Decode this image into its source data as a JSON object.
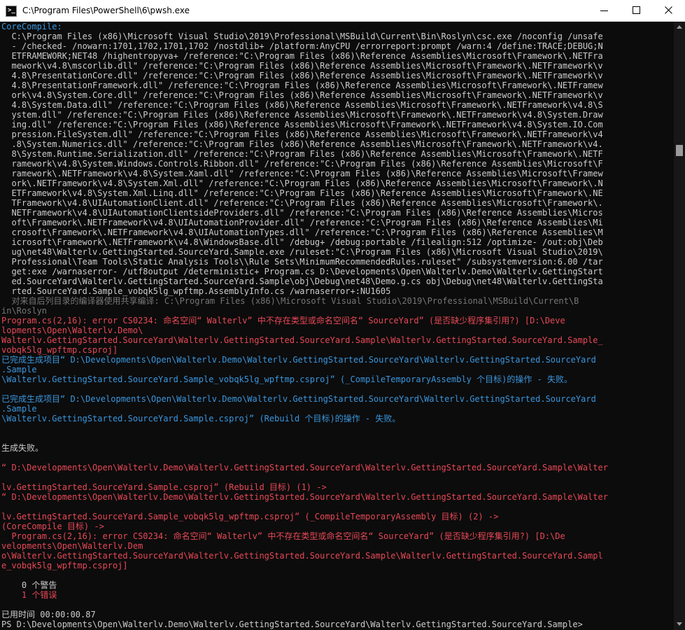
{
  "window": {
    "title": "C:\\Program Files\\PowerShell\\6\\pwsh.exe",
    "icon": "powershell-icon",
    "controls": [
      "minimize-icon",
      "maximize-icon",
      "close-icon"
    ]
  },
  "colors": {
    "background": "#0c0c0c",
    "default_text": "#cccccc",
    "label": "#3a96dd",
    "gray": "#767676",
    "error": "#e74856",
    "success": "#3a96dd"
  },
  "terminal": {
    "lines": [
      {
        "text": "CoreCompile:",
        "style": "label"
      },
      {
        "text": "  C:\\Program Files (x86)\\Microsoft Visual Studio\\2019\\Professional\\MSBuild\\Current\\Bin\\Roslyn\\csc.exe /noconfig /unsafe",
        "style": "def"
      },
      {
        "text": "  - /checked- /nowarn:1701,1702,1701,1702 /nostdlib+ /platform:AnyCPU /errorreport:prompt /warn:4 /define:TRACE;DEBUG;N",
        "style": "def"
      },
      {
        "text": "  ETFRAMEWORK;NET48 /highentropyva+ /reference:\"C:\\Program Files (x86)\\Reference Assemblies\\Microsoft\\Framework\\.NETFra",
        "style": "def"
      },
      {
        "text": "  mework\\v4.8\\mscorlib.dll\" /reference:\"C:\\Program Files (x86)\\Reference Assemblies\\Microsoft\\Framework\\.NETFramework\\v",
        "style": "def"
      },
      {
        "text": "  4.8\\PresentationCore.dll\" /reference:\"C:\\Program Files (x86)\\Reference Assemblies\\Microsoft\\Framework\\.NETFramework\\v",
        "style": "def"
      },
      {
        "text": "  4.8\\PresentationFramework.dll\" /reference:\"C:\\Program Files (x86)\\Reference Assemblies\\Microsoft\\Framework\\.NETFramew",
        "style": "def"
      },
      {
        "text": "  ork\\v4.8\\System.Core.dll\" /reference:\"C:\\Program Files (x86)\\Reference Assemblies\\Microsoft\\Framework\\.NETFramework\\v",
        "style": "def"
      },
      {
        "text": "  4.8\\System.Data.dll\" /reference:\"C:\\Program Files (x86)\\Reference Assemblies\\Microsoft\\Framework\\.NETFramework\\v4.8\\S",
        "style": "def"
      },
      {
        "text": "  ystem.dll\" /reference:\"C:\\Program Files (x86)\\Reference Assemblies\\Microsoft\\Framework\\.NETFramework\\v4.8\\System.Draw",
        "style": "def"
      },
      {
        "text": "  ing.dll\" /reference:\"C:\\Program Files (x86)\\Reference Assemblies\\Microsoft\\Framework\\.NETFramework\\v4.8\\System.IO.Com",
        "style": "def"
      },
      {
        "text": "  pression.FileSystem.dll\" /reference:\"C:\\Program Files (x86)\\Reference Assemblies\\Microsoft\\Framework\\.NETFramework\\v4",
        "style": "def"
      },
      {
        "text": "  .8\\System.Numerics.dll\" /reference:\"C:\\Program Files (x86)\\Reference Assemblies\\Microsoft\\Framework\\.NETFramework\\v4.",
        "style": "def"
      },
      {
        "text": "  8\\System.Runtime.Serialization.dll\" /reference:\"C:\\Program Files (x86)\\Reference Assemblies\\Microsoft\\Framework\\.NETF",
        "style": "def"
      },
      {
        "text": "  ramework\\v4.8\\System.Windows.Controls.Ribbon.dll\" /reference:\"C:\\Program Files (x86)\\Reference Assemblies\\Microsoft\\F",
        "style": "def"
      },
      {
        "text": "  ramework\\.NETFramework\\v4.8\\System.Xaml.dll\" /reference:\"C:\\Program Files (x86)\\Reference Assemblies\\Microsoft\\Framew",
        "style": "def"
      },
      {
        "text": "  ork\\.NETFramework\\v4.8\\System.Xml.dll\" /reference:\"C:\\Program Files (x86)\\Reference Assemblies\\Microsoft\\Framework\\.N",
        "style": "def"
      },
      {
        "text": "  ETFramework\\v4.8\\System.Xml.Linq.dll\" /reference:\"C:\\Program Files (x86)\\Reference Assemblies\\Microsoft\\Framework\\.NE",
        "style": "def"
      },
      {
        "text": "  TFramework\\v4.8\\UIAutomationClient.dll\" /reference:\"C:\\Program Files (x86)\\Reference Assemblies\\Microsoft\\Framework\\.",
        "style": "def"
      },
      {
        "text": "  NETFramework\\v4.8\\UIAutomationClientsideProviders.dll\" /reference:\"C:\\Program Files (x86)\\Reference Assemblies\\Micros",
        "style": "def"
      },
      {
        "text": "  oft\\Framework\\.NETFramework\\v4.8\\UIAutomationProvider.dll\" /reference:\"C:\\Program Files (x86)\\Reference Assemblies\\Mi",
        "style": "def"
      },
      {
        "text": "  crosoft\\Framework\\.NETFramework\\v4.8\\UIAutomationTypes.dll\" /reference:\"C:\\Program Files (x86)\\Reference Assemblies\\M",
        "style": "def"
      },
      {
        "text": "  icrosoft\\Framework\\.NETFramework\\v4.8\\WindowsBase.dll\" /debug+ /debug:portable /filealign:512 /optimize- /out:obj\\Deb",
        "style": "def"
      },
      {
        "text": "  ug\\net48\\Walterlv.GettingStarted.SourceYard.Sample.exe /ruleset:\"C:\\Program Files (x86)\\Microsoft Visual Studio\\2019\\",
        "style": "def"
      },
      {
        "text": "  Professional\\Team Tools\\Static Analysis Tools\\\\Rule Sets\\MinimumRecommendedRules.ruleset\" /subsystemversion:6.00 /tar",
        "style": "def"
      },
      {
        "text": "  get:exe /warnaserror- /utf8output /deterministic+ Program.cs D:\\Developments\\Open\\Walterlv.Demo\\Walterlv.GettingStart",
        "style": "def"
      },
      {
        "text": "  ed.SourceYard\\Walterlv.GettingStarted.SourceYard.Sample\\obj\\Debug\\net48\\Demo.g.cs obj\\Debug\\net48\\Walterlv.GettingSta",
        "style": "def"
      },
      {
        "text": "  rted.SourceYard.Sample_vobqk5lg_wpftmp.AssemblyInfo.cs /warnaserror+:NU1605",
        "style": "def"
      },
      {
        "text": "  对来自后列目录的编译器使用共享编译: C:\\Program Files (x86)\\Microsoft Visual Studio\\2019\\Professional\\MSBuild\\Current\\B",
        "style": "gray"
      },
      {
        "text": "in\\Roslyn",
        "style": "gray"
      },
      {
        "text": "Program.cs(2,16): error CS0234: 命名空间“ Walterlv” 中不存在类型或命名空间名“ SourceYard” (是否缺少程序集引用?) [D:\\Deve",
        "style": "red"
      },
      {
        "text": "lopments\\Open\\Walterlv.Demo\\",
        "style": "red"
      },
      {
        "text": "Walterlv.GettingStarted.SourceYard\\Walterlv.GettingStarted.SourceYard.Sample\\Walterlv.GettingStarted.SourceYard.Sample_",
        "style": "red"
      },
      {
        "text": "vobqk5lg_wpftmp.csproj]",
        "style": "red"
      },
      {
        "text": "已完成生成项目“ D:\\Developments\\Open\\Walterlv.Demo\\Walterlv.GettingStarted.SourceYard\\Walterlv.GettingStarted.SourceYard",
        "style": "cyan"
      },
      {
        "text": ".Sample",
        "style": "cyan"
      },
      {
        "text": "\\Walterlv.GettingStarted.SourceYard.Sample_vobqk5lg_wpftmp.csproj” (_CompileTemporaryAssembly 个目标)的操作 - 失败。",
        "style": "cyan"
      },
      {
        "text": "",
        "style": "def"
      },
      {
        "text": "已完成生成项目“ D:\\Developments\\Open\\Walterlv.Demo\\Walterlv.GettingStarted.SourceYard\\Walterlv.GettingStarted.SourceYard",
        "style": "cyan"
      },
      {
        "text": ".Sample",
        "style": "cyan"
      },
      {
        "text": "\\Walterlv.GettingStarted.SourceYard.Sample.csproj” (Rebuild 个目标)的操作 - 失败。",
        "style": "cyan"
      },
      {
        "text": "",
        "style": "def"
      },
      {
        "text": "",
        "style": "def"
      },
      {
        "text": "生成失败。",
        "style": "def"
      },
      {
        "text": "",
        "style": "def"
      },
      {
        "text": "“ D:\\Developments\\Open\\Walterlv.Demo\\Walterlv.GettingStarted.SourceYard\\Walterlv.GettingStarted.SourceYard.Sample\\Walter",
        "style": "red"
      },
      {
        "text": "",
        "style": "def"
      },
      {
        "text": "lv.GettingStarted.SourceYard.Sample.csproj” (Rebuild 目标) (1) ->",
        "style": "red"
      },
      {
        "text": "“ D:\\Developments\\Open\\Walterlv.Demo\\Walterlv.GettingStarted.SourceYard\\Walterlv.GettingStarted.SourceYard.Sample\\Walter",
        "style": "red"
      },
      {
        "text": "",
        "style": "def"
      },
      {
        "text": "lv.GettingStarted.SourceYard.Sample_vobqk5lg_wpftmp.csproj” (_CompileTemporaryAssembly 目标) (2) ->",
        "style": "red"
      },
      {
        "text": "(CoreCompile 目标) ->",
        "style": "red"
      },
      {
        "text": "  Program.cs(2,16): error CS0234: 命名空间“ Walterlv” 中不存在类型或命名空间名“ SourceYard” (是否缺少程序集引用?) [D:\\De",
        "style": "red"
      },
      {
        "text": "velopments\\Open\\Walterlv.Dem",
        "style": "red"
      },
      {
        "text": "o\\Walterlv.GettingStarted.SourceYard\\Walterlv.GettingStarted.SourceYard.Sample\\Walterlv.GettingStarted.SourceYard.Sampl",
        "style": "red"
      },
      {
        "text": "e_vobqk5lg_wpftmp.csproj]",
        "style": "red"
      },
      {
        "text": "",
        "style": "def"
      },
      {
        "text": "    0 个警告",
        "style": "def"
      },
      {
        "text": "    1 个错误",
        "style": "red"
      },
      {
        "text": "",
        "style": "def"
      },
      {
        "text": "已用时间 00:00:00.87",
        "style": "def"
      },
      {
        "text": "PS D:\\Developments\\Open\\Walterlv.Demo\\Walterlv.GettingStarted.SourceYard\\Walterlv.GettingStarted.SourceYard.Sample>",
        "style": "def"
      }
    ]
  }
}
